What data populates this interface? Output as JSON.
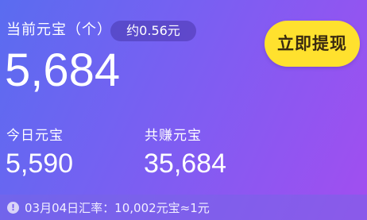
{
  "balance": {
    "label": "当前元宝（个）",
    "approx_value": "约0.56元",
    "value": "5,684"
  },
  "withdraw_button": {
    "label": "立即提现"
  },
  "stats": {
    "today": {
      "label": "今日元宝",
      "value": "5,590"
    },
    "total": {
      "label": "共赚元宝",
      "value": "35,684"
    }
  },
  "exchange_notice": {
    "icon": "exclamation-icon",
    "text": "03月04日汇率：10,002元宝≈1元"
  },
  "colors": {
    "gradient_start": "#5a6cf0",
    "gradient_end": "#a24ef0",
    "button_accent": "#ffe12e"
  }
}
